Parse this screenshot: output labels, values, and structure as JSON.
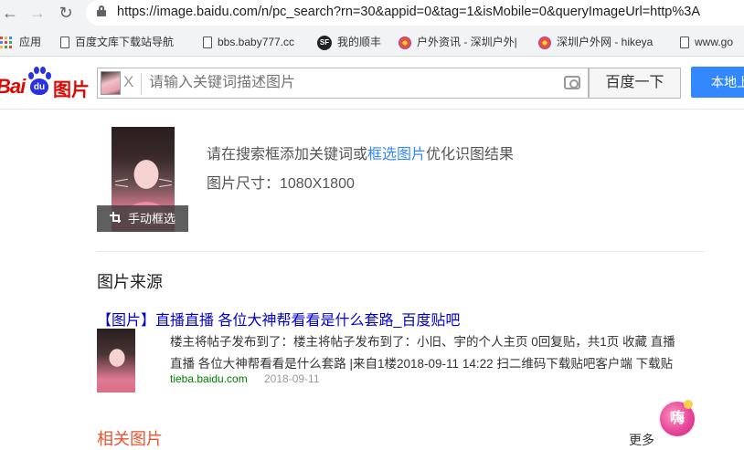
{
  "browser": {
    "url": "https://image.baidu.com/n/pc_search?rn=30&appid=0&tag=1&isMobile=0&queryImageUrl=http%3A",
    "bookmarks": [
      {
        "label": "应用",
        "icon": "apps-grid-icon"
      },
      {
        "label": "百度文库下载站导航",
        "icon": "page-icon"
      },
      {
        "label": "bbs.baby777.cc",
        "icon": "page-icon"
      },
      {
        "label": "我的顺丰",
        "icon": "sf-express-icon"
      },
      {
        "label": "户外资讯 - 深圳户外|",
        "icon": "flower-icon"
      },
      {
        "label": "深圳户外网 - hikeya",
        "icon": "flower-icon"
      },
      {
        "label": "www.go",
        "icon": "page-icon"
      }
    ]
  },
  "header": {
    "logo": {
      "bai": "Bai",
      "du": "du",
      "tupian": "图片"
    },
    "search_placeholder": "请输入关键词描述图片",
    "close_label": "X",
    "search_button": "百度一下",
    "upload_button": "本地上"
  },
  "query_image": {
    "crop_label": "手动框选",
    "hint_prefix": "请在搜索框添加关键词或",
    "hint_link": "框选图片",
    "hint_suffix": "优化识图结果",
    "size_text": "图片尺寸：1080X1800"
  },
  "source_section": {
    "heading": "图片来源",
    "result": {
      "title": "【图片】直播直播 各位大神帮看看是什么套路_百度贴吧",
      "desc_line1": "楼主将帖子发布到了：楼主将帖子发布到了：小旧、宇的个人主页 0回复贴，共1页 收藏 直播",
      "desc_line2": "直播 各位大神帮看看是什么套路 |来自1楼2018-09-11 14:22 扫二维码下载贴吧客户端 下载贴",
      "site": "tieba.baidu.com",
      "date": "2018-09-11"
    }
  },
  "related_section": {
    "heading": "相关图片",
    "more": "更多",
    "badge_char": "嗨"
  }
}
